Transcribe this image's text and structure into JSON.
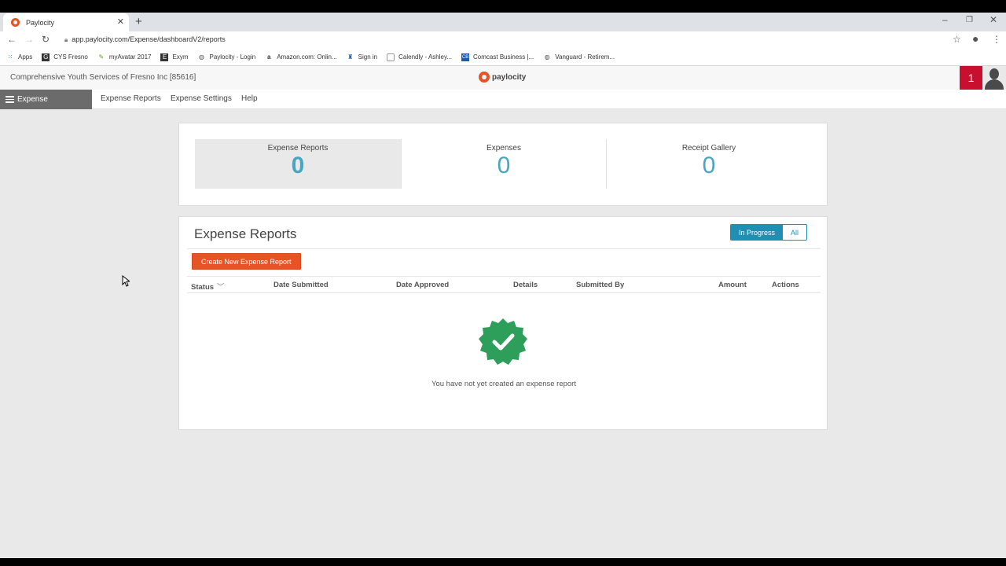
{
  "browser": {
    "tab_title": "Paylocity",
    "url": "app.paylocity.com/Expense/dashboardV2/reports",
    "bookmarks": [
      {
        "label": "Apps",
        "icon": "apps-grid-icon"
      },
      {
        "label": "CYS Fresno",
        "icon": "g-icon"
      },
      {
        "label": "myAvatar 2017",
        "icon": "avatar-bookmark-icon"
      },
      {
        "label": "Exym",
        "icon": "e-icon"
      },
      {
        "label": "Paylocity - Login",
        "icon": "globe-icon"
      },
      {
        "label": "Amazon.com: Onlin...",
        "icon": "amazon-icon"
      },
      {
        "label": "Sign in",
        "icon": "signin-icon"
      },
      {
        "label": "Calendly - Ashley...",
        "icon": "calendly-icon"
      },
      {
        "label": "Comcast Business |...",
        "icon": "cb-icon"
      },
      {
        "label": "Vanguard - Retirem...",
        "icon": "globe-icon"
      }
    ]
  },
  "header": {
    "company": "Comprehensive Youth Services of Fresno Inc [85616]",
    "logo_text": "paylocity",
    "notification_count": "1",
    "brand_color": "#e65325",
    "alert_color": "#c8102e"
  },
  "subnav": {
    "module": "Expense",
    "links": [
      "Expense Reports",
      "Expense Settings",
      "Help"
    ]
  },
  "summary": {
    "tiles": [
      {
        "label": "Expense Reports",
        "value": "0",
        "active": true
      },
      {
        "label": "Expenses",
        "value": "0",
        "active": false
      },
      {
        "label": "Receipt Gallery",
        "value": "0",
        "active": false
      }
    ],
    "accent_color": "#46a6c4"
  },
  "reports": {
    "title": "Expense Reports",
    "filter_options": [
      "In Progress",
      "All"
    ],
    "selected_filter": "In Progress",
    "create_button": "Create New Expense Report",
    "columns": [
      "Status",
      "Date Submitted",
      "Date Approved",
      "Details",
      "Submitted By",
      "Amount",
      "Actions"
    ],
    "rows": [],
    "empty_message": "You have not yet created an expense report",
    "empty_icon": "verified-badge-icon"
  }
}
